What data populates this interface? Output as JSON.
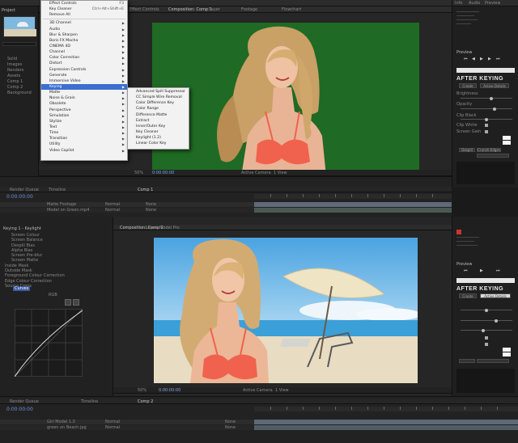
{
  "project_panel": {
    "tab": "Project",
    "folder_items": [
      "Solid",
      "Images",
      "Renders",
      "Assets",
      "Comp 1",
      "Comp 2",
      "Background"
    ]
  },
  "viewer_top": {
    "tabs": [
      "Effect Controls",
      "Composition: Comp 1",
      "Layer",
      "Footage",
      "Flowchart"
    ],
    "zoom": "50%",
    "footer_time": "0:00:00:00",
    "view": "Active Camera",
    "views": "1 View"
  },
  "effects_menu": {
    "items": [
      {
        "label": "Effect Controls",
        "shortcut": "F3",
        "sub": false
      },
      {
        "label": "Key Cleaner",
        "shortcut": "Ctrl+Alt+Shift+E",
        "sub": false
      },
      {
        "label": "Remove All",
        "shortcut": "",
        "sub": false
      },
      {
        "sep": true
      },
      {
        "label": "3D Channel",
        "sub": true
      },
      {
        "label": "Audio",
        "sub": true
      },
      {
        "label": "Blur & Sharpen",
        "sub": true
      },
      {
        "label": "Boris FX Mocha",
        "sub": true
      },
      {
        "label": "CINEMA 4D",
        "sub": true
      },
      {
        "label": "Channel",
        "sub": true
      },
      {
        "label": "Color Correction",
        "sub": true
      },
      {
        "label": "Distort",
        "sub": true
      },
      {
        "label": "Expression Controls",
        "sub": true
      },
      {
        "label": "Generate",
        "sub": true
      },
      {
        "label": "Immersive Video",
        "sub": true
      },
      {
        "label": "Keying",
        "sub": true,
        "highlight": true
      },
      {
        "label": "Matte",
        "sub": true
      },
      {
        "label": "Noise & Grain",
        "sub": true
      },
      {
        "label": "Obsolete",
        "sub": true
      },
      {
        "label": "Perspective",
        "sub": true
      },
      {
        "label": "Simulation",
        "sub": true
      },
      {
        "label": "Stylize",
        "sub": true
      },
      {
        "label": "Text",
        "sub": true
      },
      {
        "label": "Time",
        "sub": true
      },
      {
        "label": "Transition",
        "sub": true
      },
      {
        "label": "Utility",
        "sub": true
      },
      {
        "label": "Video Copilot",
        "sub": true
      }
    ]
  },
  "keying_submenu": {
    "items": [
      "Advanced Spill Suppressor",
      "CC Simple Wire Removal",
      "Color Difference Key",
      "Color Range",
      "Difference Matte",
      "Extract",
      "Inner/Outer Key",
      "Key Cleaner",
      "Keylight (1.2)",
      "Linear Color Key"
    ]
  },
  "right_panel_top": {
    "tabs": [
      "Info",
      "Audio",
      "Preview"
    ],
    "preview_label": "Preview",
    "plugin_title": "AFTER KEYING",
    "fields": [
      "Screen",
      "Active Details",
      "Brightness",
      "Opacity",
      "Clip Black",
      "Clip White",
      "Screen Gain",
      "Despill",
      "Edge Softness",
      "Edge Feather"
    ],
    "buttons": [
      "Create",
      "Crunch Edges",
      "Despill"
    ]
  },
  "right_panel_bottom": {
    "preview_label": "Preview",
    "plugin_title": "AFTER KEYING",
    "mode_button": "Create",
    "mode_dropdown": "Active Details"
  },
  "timeline_top": {
    "tabs": [
      "Render Queue",
      "Timeline",
      "Comp 1"
    ],
    "timecode": "0:00:00:00",
    "layers": [
      "Matte Footage",
      "Model on Green.mp4"
    ],
    "mode": "Normal",
    "parent": "None"
  },
  "effect_controls_panel": {
    "header": "Keying 1 - Keylight",
    "rows": [
      "Screen Colour",
      "Screen Balance",
      "Despill Bias",
      "Alpha Bias",
      "Screen Pre-blur",
      "Screen Matte",
      "Inside Mask",
      "Outside Mask",
      "Foreground Colour Correction",
      "Edge Colour Correction",
      "Source Crops"
    ],
    "curves_label": "Curves",
    "channel": "RGB"
  },
  "viewer_bottom": {
    "tabs": [
      "Composition: Comp 2",
      "Layer: Model Pro"
    ],
    "zoom": "50%",
    "footer_time": "0:00:00:00",
    "view": "Active Camera",
    "views": "1 View"
  },
  "timeline_bottom": {
    "tabs": [
      "Render Queue",
      "Timeline",
      "Comp 2"
    ],
    "timecode": "0:00:00:00",
    "layers": [
      "Girl Model 1.0",
      "green on Beach.jpg"
    ],
    "mode": "Normal",
    "parent": "None"
  },
  "colors": {
    "green_screen": "#1f6a24",
    "menu_highlight": "#3b6fd0",
    "sky": "#6bb5e6",
    "sand": "#e8dcc3",
    "sea": "#3b9fd8"
  }
}
